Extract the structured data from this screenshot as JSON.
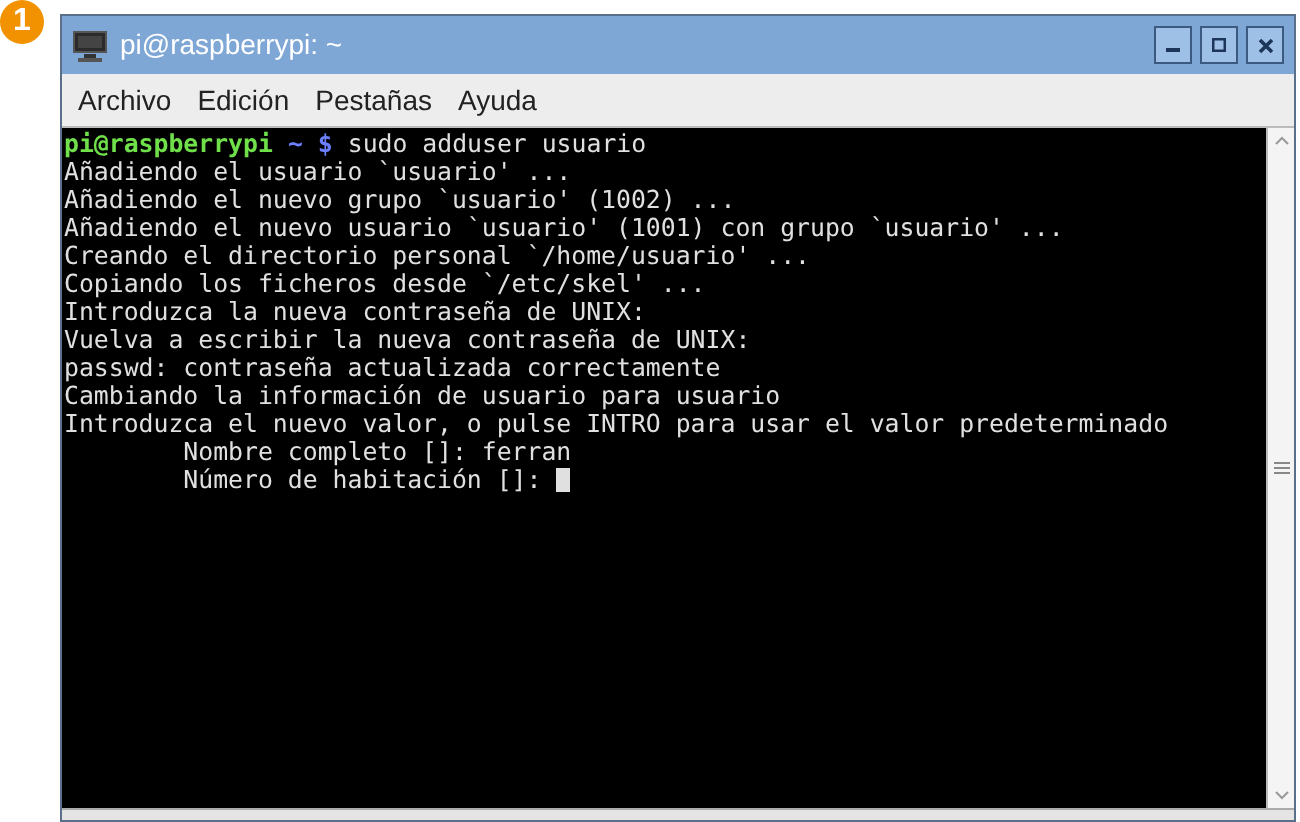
{
  "badge": "1",
  "window": {
    "title": "pi@raspberrypi: ~"
  },
  "menu": [
    "Archivo",
    "Edición",
    "Pestañas",
    "Ayuda"
  ],
  "terminal": {
    "prompt": {
      "user_host": "pi@raspberrypi",
      "path": "~",
      "symbol": "$",
      "command": "sudo adduser usuario"
    },
    "lines": [
      {
        "text": "Añadiendo el usuario `usuario' ..."
      },
      {
        "text": "Añadiendo el nuevo grupo `usuario' (1002) ..."
      },
      {
        "text": "Añadiendo el nuevo usuario `usuario' (1001) con grupo `usuario' ..."
      },
      {
        "text": "Creando el directorio personal `/home/usuario' ..."
      },
      {
        "text": "Copiando los ficheros desde `/etc/skel' ..."
      },
      {
        "text": "Introduzca la nueva contraseña de UNIX:"
      },
      {
        "text": "Vuelva a escribir la nueva contraseña de UNIX:"
      },
      {
        "text": "passwd: contraseña actualizada correctamente"
      },
      {
        "text": "Cambiando la información de usuario para usuario"
      },
      {
        "text": "Introduzca el nuevo valor, o pulse INTRO para usar el valor predeterminado"
      },
      {
        "text": "        Nombre completo []: ferran"
      },
      {
        "text": "        Número de habitación []:",
        "cursor": true
      }
    ]
  }
}
